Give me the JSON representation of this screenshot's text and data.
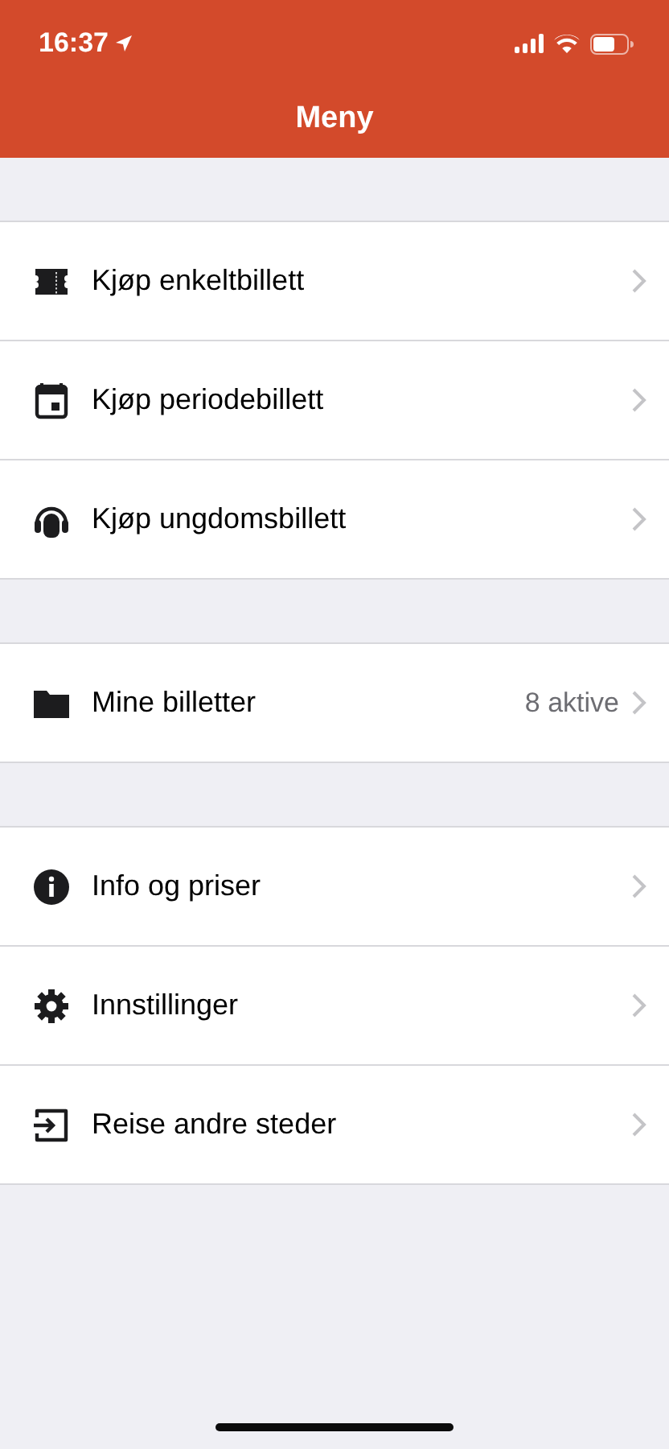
{
  "status_bar": {
    "time": "16:37"
  },
  "header": {
    "title": "Meny"
  },
  "sections": [
    {
      "items": [
        {
          "kind": "ticket",
          "label": "Kjøp enkeltbillett"
        },
        {
          "kind": "calendar",
          "label": "Kjøp periodebillett"
        },
        {
          "kind": "headphones",
          "label": "Kjøp ungdomsbillett"
        }
      ]
    },
    {
      "items": [
        {
          "kind": "folder",
          "label": "Mine billetter",
          "detail": "8 aktive"
        }
      ]
    },
    {
      "items": [
        {
          "kind": "info",
          "label": "Info og priser"
        },
        {
          "kind": "gear",
          "label": "Innstillinger"
        },
        {
          "kind": "exit",
          "label": "Reise andre steder"
        }
      ]
    }
  ]
}
